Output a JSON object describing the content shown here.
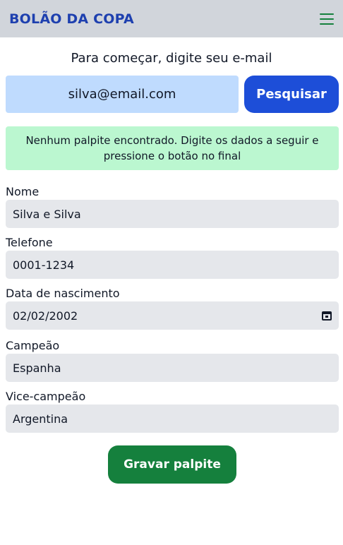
{
  "header": {
    "brand": "BOLÃO DA COPA",
    "menu_icon": "hamburger-menu-icon"
  },
  "search": {
    "prompt": "Para começar, digite seu e-mail",
    "email_value": "silva@email.com",
    "button_label": "Pesquisar"
  },
  "notice": {
    "text": "Nenhum palpite encontrado. Digite os dados a seguir e pressione o botão no final"
  },
  "form": {
    "name": {
      "label": "Nome",
      "value": "Silva e Silva"
    },
    "phone": {
      "label": "Telefone",
      "value": "0001-1234"
    },
    "birthdate": {
      "label": "Data de nascimento",
      "value": "02/02/2002",
      "icon": "calendar-icon"
    },
    "champion": {
      "label": "Campeão",
      "value": "Espanha"
    },
    "runner_up": {
      "label": "Vice-campeão",
      "value": "Argentina"
    },
    "submit_label": "Gravar palpite"
  },
  "colors": {
    "header_bg": "#d1d5db",
    "brand": "#1e40af",
    "primary_button": "#1d4ed8",
    "input_highlight": "#bfdbfe",
    "notice_bg": "#bbf7d0",
    "success_button": "#15803d",
    "field_bg": "#e5e7eb"
  }
}
